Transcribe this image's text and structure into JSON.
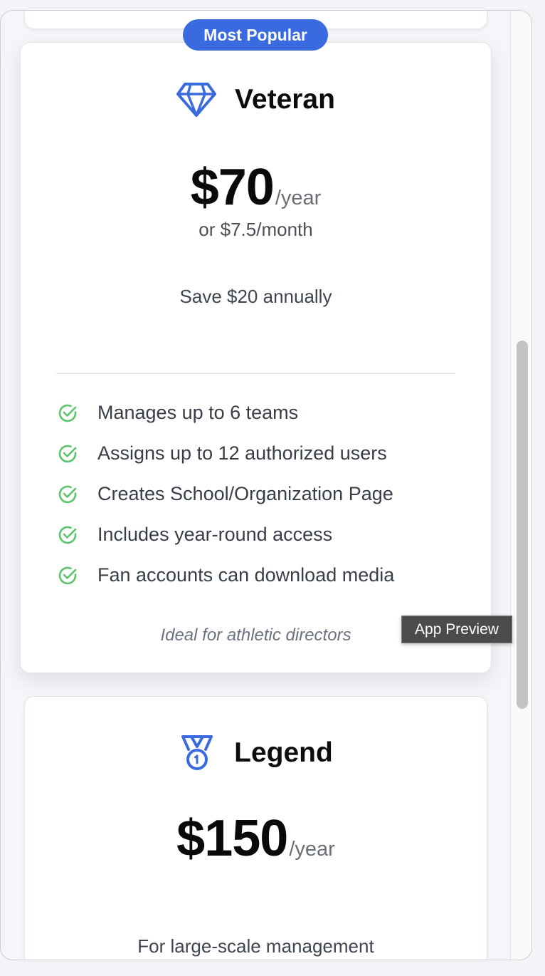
{
  "tooltip": "App Preview",
  "veteran": {
    "badge": "Most Popular",
    "icon": "diamond-icon",
    "name": "Veteran",
    "price": "$70",
    "period": "/year",
    "monthly": "or $7.5/month",
    "savings": "Save $20 annually",
    "features": [
      "Manages up to 6 teams",
      "Assigns up to 12 authorized users",
      "Creates School/Organization Page",
      "Includes year-round access",
      "Fan accounts can download media"
    ],
    "ideal": "Ideal for athletic directors"
  },
  "legend": {
    "icon": "medal-icon",
    "name": "Legend",
    "price": "$150",
    "period": "/year",
    "tagline": "For large-scale management"
  },
  "colors": {
    "accent": "#3a6ae0",
    "check": "#5cc46a",
    "tooltip_bg": "#4b4b4b"
  }
}
